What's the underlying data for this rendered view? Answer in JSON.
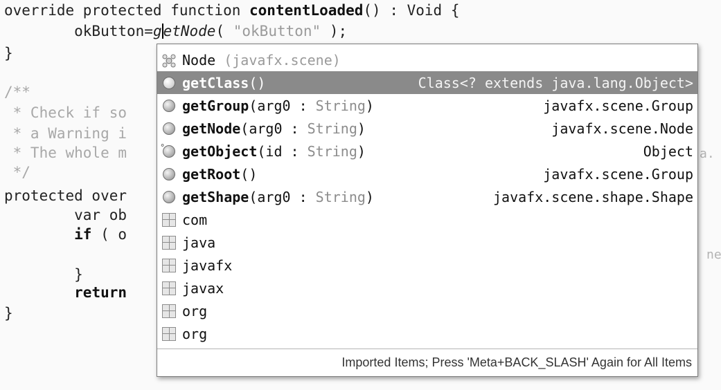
{
  "editor": {
    "line1": {
      "prefix": "override protected function ",
      "method": "contentLoaded",
      "suffix": "() : Void {"
    },
    "line2": {
      "indent": "        okButton=",
      "call_before_caret": "g",
      "call_after_caret": "etNode",
      "open": "( ",
      "arg": "\"okButton\"",
      "close": " );"
    },
    "line3": "}",
    "comment_lines": [
      "/**",
      " * Check if so",
      " * a Warning i",
      " * The whole m",
      " */"
    ],
    "line_protected": "protected over",
    "line_var": "        var ob",
    "line_if_kw": "if",
    "line_if_rest": " ( o",
    "line_close_brace": "        }",
    "line_return_kw": "return",
    "line_end": "}",
    "stray_right_1": "a.",
    "stray_right_2": "ne"
  },
  "popup": {
    "items": [
      {
        "kind": "class",
        "name": "Node",
        "name_bold": false,
        "sig": "",
        "suffix": " (javafx.scene)",
        "type": ""
      },
      {
        "kind": "method",
        "name": "getClass",
        "sig": "()",
        "type": "Class<? extends java.lang.Object>",
        "selected": true
      },
      {
        "kind": "method",
        "name": "getGroup",
        "sig_open": "(arg0 : ",
        "ptype": "String",
        "sig_close": ")",
        "type": "javafx.scene.Group"
      },
      {
        "kind": "method",
        "name": "getNode",
        "sig_open": "(arg0 : ",
        "ptype": "String",
        "sig_close": ")",
        "type": "javafx.scene.Node"
      },
      {
        "kind": "method-locked",
        "name": "getObject",
        "sig_open": "(id : ",
        "ptype": "String",
        "sig_close": ")",
        "type": "Object"
      },
      {
        "kind": "method",
        "name": "getRoot",
        "sig": "()",
        "type": "javafx.scene.Group"
      },
      {
        "kind": "method",
        "name": "getShape",
        "sig_open": "(arg0 : ",
        "ptype": "String",
        "sig_close": ")",
        "type": "javafx.scene.shape.Shape"
      },
      {
        "kind": "package",
        "name": "com"
      },
      {
        "kind": "package",
        "name": "java"
      },
      {
        "kind": "package",
        "name": "javafx"
      },
      {
        "kind": "package",
        "name": "javax"
      },
      {
        "kind": "package",
        "name": "org"
      },
      {
        "kind": "package",
        "name": "org"
      }
    ],
    "footer": "Imported Items; Press 'Meta+BACK_SLASH' Again for All Items"
  },
  "icons": {
    "method": "method-icon",
    "package": "package-icon",
    "class": "class-icon",
    "locked": "lock-icon"
  }
}
